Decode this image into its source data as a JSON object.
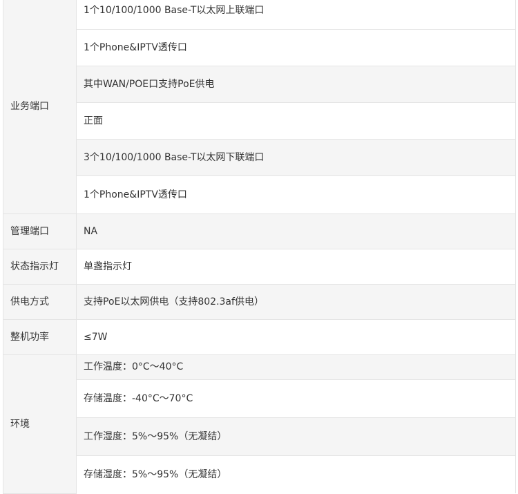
{
  "rows": [
    {
      "label": "业务端口",
      "values": [
        "1个10/100/1000 Base-T以太网上联端口",
        "1个Phone&IPTV透传口",
        "其中WAN/POE口支持PoE供电",
        "正面",
        "3个10/100/1000 Base-T以太网下联端口",
        "1个Phone&IPTV透传口"
      ]
    },
    {
      "label": "管理端口",
      "values": [
        "NA"
      ]
    },
    {
      "label": "状态指示灯",
      "values": [
        "单盏指示灯"
      ]
    },
    {
      "label": "供电方式",
      "values": [
        "支持PoE以太网供电（支持802.3af供电）"
      ]
    },
    {
      "label": "整机功率",
      "values": [
        "≤7W"
      ]
    },
    {
      "label": "环境",
      "values": [
        "工作温度：0°C～40°C",
        "存储温度：-40°C～70°C",
        "工作湿度：5%～95%（无凝结）",
        "存储湿度：5%～95%（无凝结）"
      ]
    }
  ]
}
